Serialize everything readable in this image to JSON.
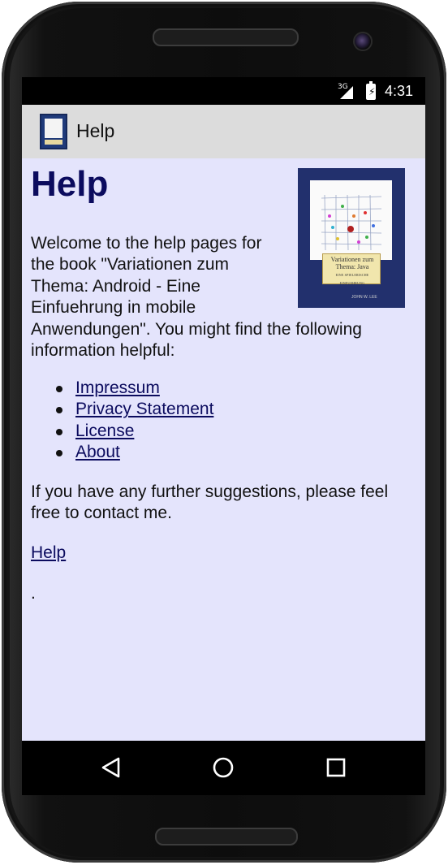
{
  "statusbar": {
    "network_label": "3G",
    "time": "4:31"
  },
  "appbar": {
    "title": "Help",
    "icon": "book-cover-icon"
  },
  "content": {
    "heading": "Help",
    "intro_lines": [
      "Welcome to the help pages for",
      "the book \"Variationen zum",
      "Thema: Android - Eine",
      "Einfuehrung in mobile",
      "Anwendungen\".  You might find the following",
      "information helpful:"
    ],
    "links": [
      {
        "label": "Impressum"
      },
      {
        "label": "Privacy Statement"
      },
      {
        "label": "License"
      },
      {
        "label": "About"
      }
    ],
    "further_lines": [
      "If you have any further suggestions, please feel",
      "free to contact me."
    ],
    "help_link": "Help",
    "trailing": ".",
    "cover": {
      "title_line1": "Variationen zum",
      "title_line2": "Thema: Java",
      "subtitle": "EINE SPIELERISCHE EINFUEHRUNG",
      "author": "JOHN W. LEE",
      "colors": {
        "background": "#22306d",
        "label": "#f1e6ad"
      }
    }
  },
  "navbar": {
    "back_icon": "back-triangle-icon",
    "home_icon": "home-circle-icon",
    "recents_icon": "recents-square-icon"
  },
  "colors": {
    "page_background": "#e4e4fc",
    "heading": "#0b0b5e",
    "appbar": "#dcdcdc"
  }
}
